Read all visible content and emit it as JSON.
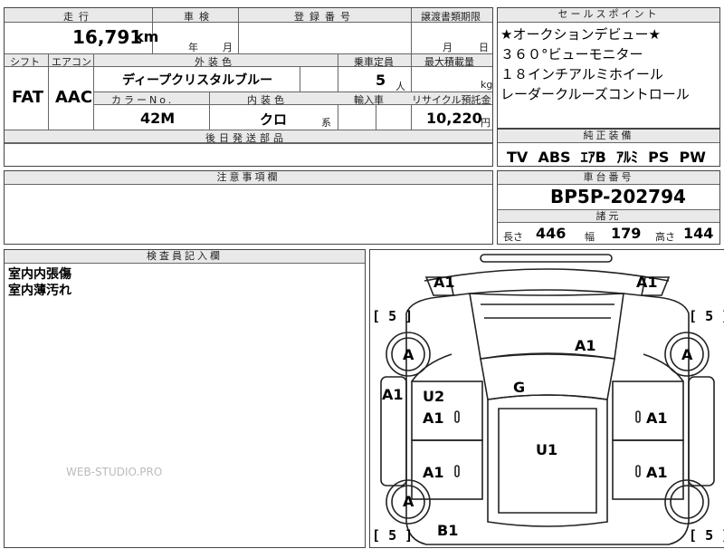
{
  "colors": {
    "header_bg": "#e9e9e9",
    "line": "#444444",
    "text": "#000000",
    "watermark": "#bbbbbb"
  },
  "top_left": {
    "mileage": {
      "label": "走行",
      "value": "16,791",
      "unit": "km"
    },
    "inspection": {
      "label": "車検",
      "year_unit": "年",
      "month_unit": "月"
    },
    "registration": {
      "label": "登録番号"
    },
    "transfer_deadline": {
      "label": "譲渡書類期限",
      "month_unit": "月",
      "day_unit": "日"
    },
    "shift": {
      "label": "シフト",
      "value": "FAT"
    },
    "aircon": {
      "label": "エアコン",
      "value": "AAC"
    },
    "exterior_color": {
      "label": "外装色",
      "value": "ディープクリスタルブルー"
    },
    "color_no": {
      "label": "カラーNo.",
      "value": "42M"
    },
    "interior_color": {
      "label": "内装色",
      "value": "クロ",
      "suffix": "系"
    },
    "capacity": {
      "label": "乗車定員",
      "value": "5",
      "unit": "人"
    },
    "max_load": {
      "label": "最大積載量",
      "unit": "kg"
    },
    "import": {
      "label": "輸入車"
    },
    "recycle": {
      "label": "リサイクル預託金",
      "value": "10,220",
      "unit": "円"
    },
    "later_parts": {
      "label": "後日発送部品"
    }
  },
  "sales_points": {
    "label": "セールスポイント",
    "items": [
      "★オークションデビュー★",
      "３６０°ビューモニター",
      "１８インチアルミホイール",
      "レーダークルーズコントロール"
    ]
  },
  "genuine_equipment": {
    "label": "純正装備",
    "value": "TV  ABS  ｴｱB  ｱﾙﾐ  PS  PW"
  },
  "notes": {
    "label": "注意事項欄"
  },
  "chassis": {
    "label": "車台番号",
    "value": "BP5P-202794"
  },
  "specs": {
    "label": "諸元",
    "length": {
      "label": "長さ",
      "value": "446"
    },
    "width": {
      "label": "幅",
      "value": "179"
    },
    "height": {
      "label": "高さ",
      "value": "144"
    }
  },
  "inspector": {
    "label": "検査員記入欄",
    "lines": [
      "室内内張傷",
      "室内薄汚れ"
    ]
  },
  "diagram": {
    "marks": {
      "mirror_left": "A1",
      "mirror_right": "A1",
      "hood": "A1",
      "windshield_area": "G",
      "fender_left": "A1",
      "front_door_left_u": "U2",
      "front_door_left": "A1",
      "front_door_right": "A1",
      "rear_door_left": "A1",
      "rear_door_right": "A1",
      "roof": "U1",
      "rear_left": "B1",
      "wheel_fl": "A",
      "wheel_fr": "A",
      "wheel_rl": "A"
    },
    "tire_fl": "5",
    "tire_fr": "5",
    "tire_rl": "5",
    "tire_rr": "5"
  },
  "watermark": "WEB-STUDIO.PRO"
}
